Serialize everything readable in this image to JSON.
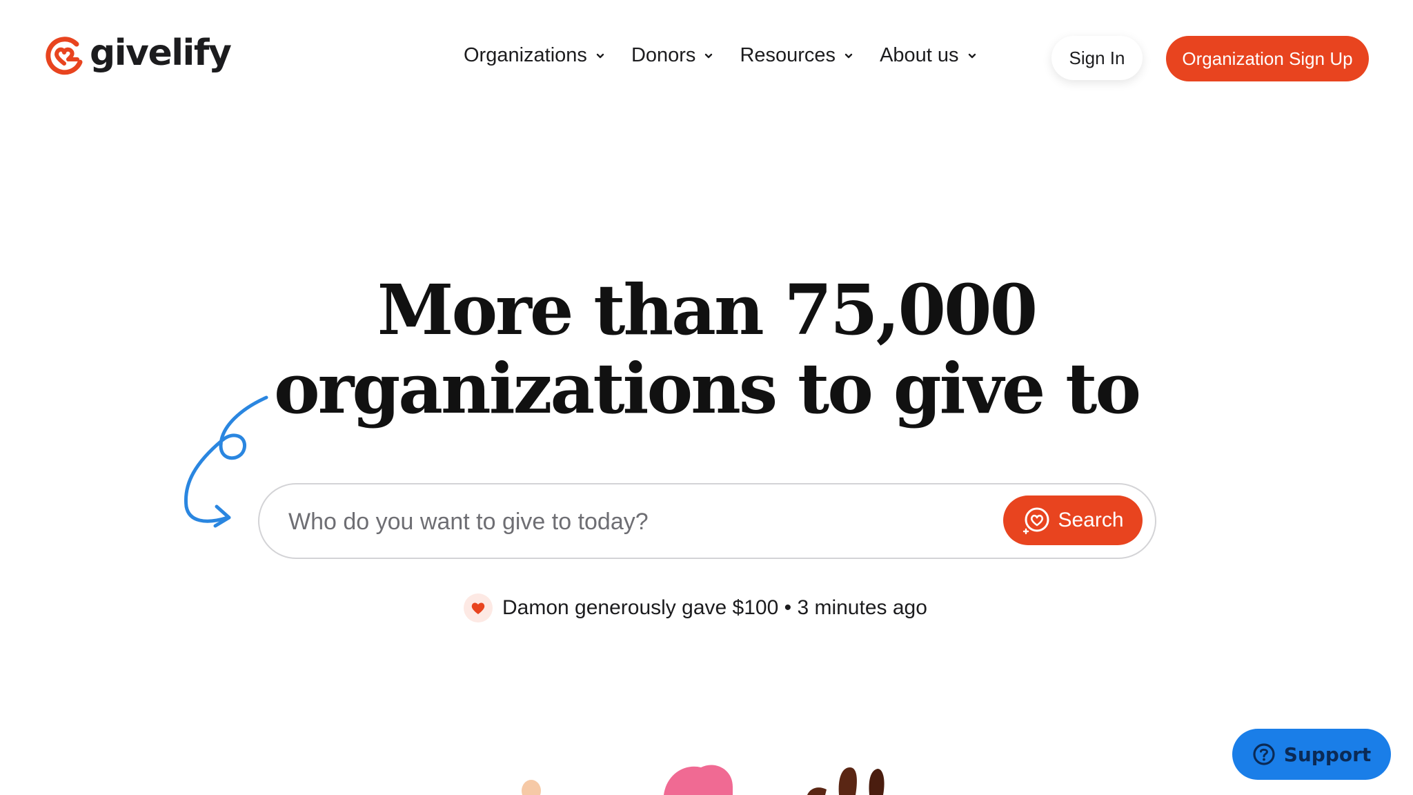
{
  "brand": {
    "name": "givelify",
    "accent": "#e8441f",
    "support_blue": "#1a7ee8"
  },
  "nav": {
    "items": [
      {
        "label": "Organizations"
      },
      {
        "label": "Donors"
      },
      {
        "label": "Resources"
      },
      {
        "label": "About us"
      }
    ],
    "signin_label": "Sign In",
    "signup_label": "Organization Sign Up"
  },
  "hero": {
    "headline_line1": "More than 75,000",
    "headline_line2": "organizations to give to",
    "search_placeholder": "Who do you want to give to today?",
    "search_button": "Search",
    "activity": "Damon generously gave $100 • 3 minutes ago"
  },
  "support": {
    "label": "Support"
  },
  "icons": [
    "givelify-logo-icon",
    "chevron-down-icon",
    "curly-arrow-icon",
    "heart-search-icon",
    "heart-icon",
    "question-icon"
  ]
}
